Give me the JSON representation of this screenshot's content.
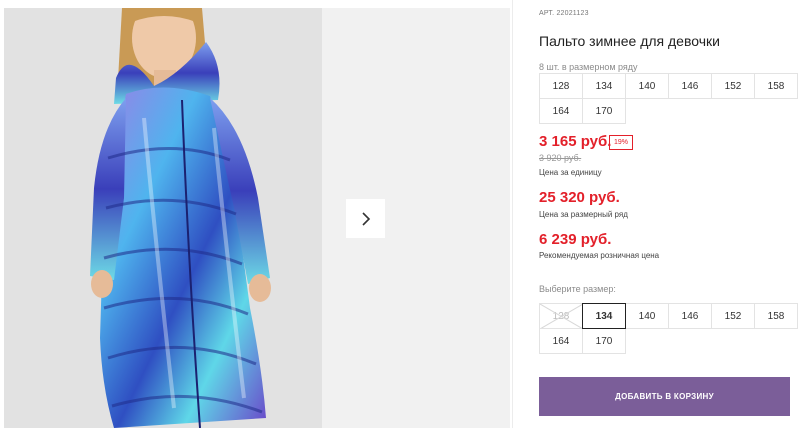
{
  "product": {
    "sku_label": "АРТ.",
    "sku": "22021123",
    "title": "Пальто зимнее для девочки"
  },
  "size_row": {
    "caption": "8 шт. в размерном ряду",
    "sizes": [
      "128",
      "134",
      "140",
      "146",
      "152",
      "158",
      "164",
      "170"
    ]
  },
  "pricing": {
    "unit_price": "3 165 руб.",
    "discount": "19%",
    "old_price": "3 920 руб.",
    "unit_caption": "Цена за единицу",
    "row_price": "25 320 руб.",
    "row_caption": "Цена за размерный ряд",
    "retail_price": "6 239 руб.",
    "retail_caption": "Рекомендуемая розничная цена"
  },
  "size_select": {
    "caption": "Выберите размер:",
    "sizes": [
      "128",
      "134",
      "140",
      "146",
      "152",
      "158",
      "164",
      "170"
    ],
    "selected": "134",
    "disabled": [
      "128"
    ]
  },
  "actions": {
    "add_to_cart": "Добавить в корзину"
  },
  "gallery": {
    "next_icon": "chevron-right-icon"
  },
  "colors": {
    "price_red": "#e3202a",
    "button_purple": "#7b5e99"
  }
}
